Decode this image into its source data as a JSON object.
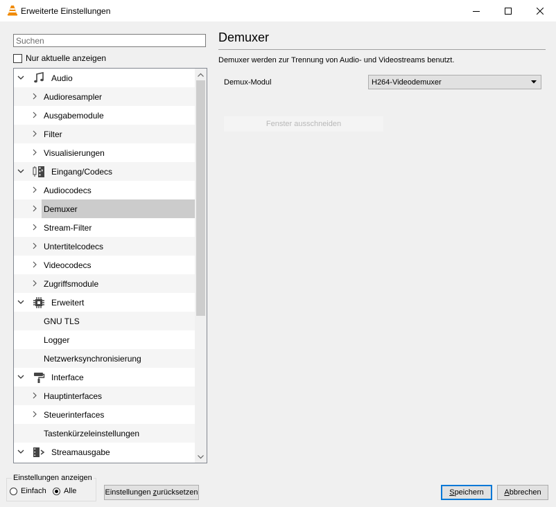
{
  "window": {
    "title": "Erweiterte Einstellungen"
  },
  "search": {
    "placeholder": "Suchen"
  },
  "only_current": {
    "label": "Nur aktuelle anzeigen",
    "checked": false
  },
  "tree": {
    "items": [
      {
        "label": "Audio",
        "level": 0,
        "expanded": true,
        "icon": "music-note-icon"
      },
      {
        "label": "Audioresampler",
        "level": 1,
        "has_children": true
      },
      {
        "label": "Ausgabemodule",
        "level": 1,
        "has_children": true
      },
      {
        "label": "Filter",
        "level": 1,
        "has_children": true
      },
      {
        "label": "Visualisierungen",
        "level": 1,
        "has_children": true
      },
      {
        "label": "Eingang/Codecs",
        "level": 0,
        "expanded": true,
        "icon": "codec-film-icon"
      },
      {
        "label": "Audiocodecs",
        "level": 1,
        "has_children": true
      },
      {
        "label": "Demuxer",
        "level": 1,
        "has_children": true,
        "selected": true
      },
      {
        "label": "Stream-Filter",
        "level": 1,
        "has_children": true
      },
      {
        "label": "Untertitelcodecs",
        "level": 1,
        "has_children": true
      },
      {
        "label": "Videocodecs",
        "level": 1,
        "has_children": true
      },
      {
        "label": "Zugriffsmodule",
        "level": 1,
        "has_children": true
      },
      {
        "label": "Erweitert",
        "level": 0,
        "expanded": true,
        "icon": "chip-icon"
      },
      {
        "label": "GNU TLS",
        "level": 1,
        "has_children": false
      },
      {
        "label": "Logger",
        "level": 1,
        "has_children": false
      },
      {
        "label": "Netzwerksynchronisierung",
        "level": 1,
        "has_children": false
      },
      {
        "label": "Interface",
        "level": 0,
        "expanded": true,
        "icon": "paint-roller-icon"
      },
      {
        "label": "Hauptinterfaces",
        "level": 1,
        "has_children": true
      },
      {
        "label": "Steuerinterfaces",
        "level": 1,
        "has_children": true
      },
      {
        "label": "Tastenkürzeleinstellungen",
        "level": 1,
        "has_children": false
      },
      {
        "label": "Streamausgabe",
        "level": 0,
        "expanded": true,
        "icon": "stream-output-icon"
      }
    ]
  },
  "panel": {
    "title": "Demuxer",
    "description": "Demuxer werden zur Trennung von Audio- und Videostreams benutzt.",
    "demux_label": "Demux-Modul",
    "demux_value": "H264-Videodemuxer",
    "crop_button": "Fenster ausschneiden"
  },
  "footer": {
    "group_label": "Einstellungen anzeigen",
    "simple": "Einfach",
    "all": "Alle",
    "selected": "all",
    "reset": {
      "pre": "Einstellungen ",
      "key": "z",
      "post": "urücksetzen"
    },
    "save": {
      "key": "S",
      "rest": "peichern"
    },
    "cancel": {
      "key": "A",
      "rest": "bbrechen"
    }
  },
  "colors": {
    "selection": "#cccccc",
    "accent": "#0078d7",
    "cone_orange": "#f08a00"
  }
}
